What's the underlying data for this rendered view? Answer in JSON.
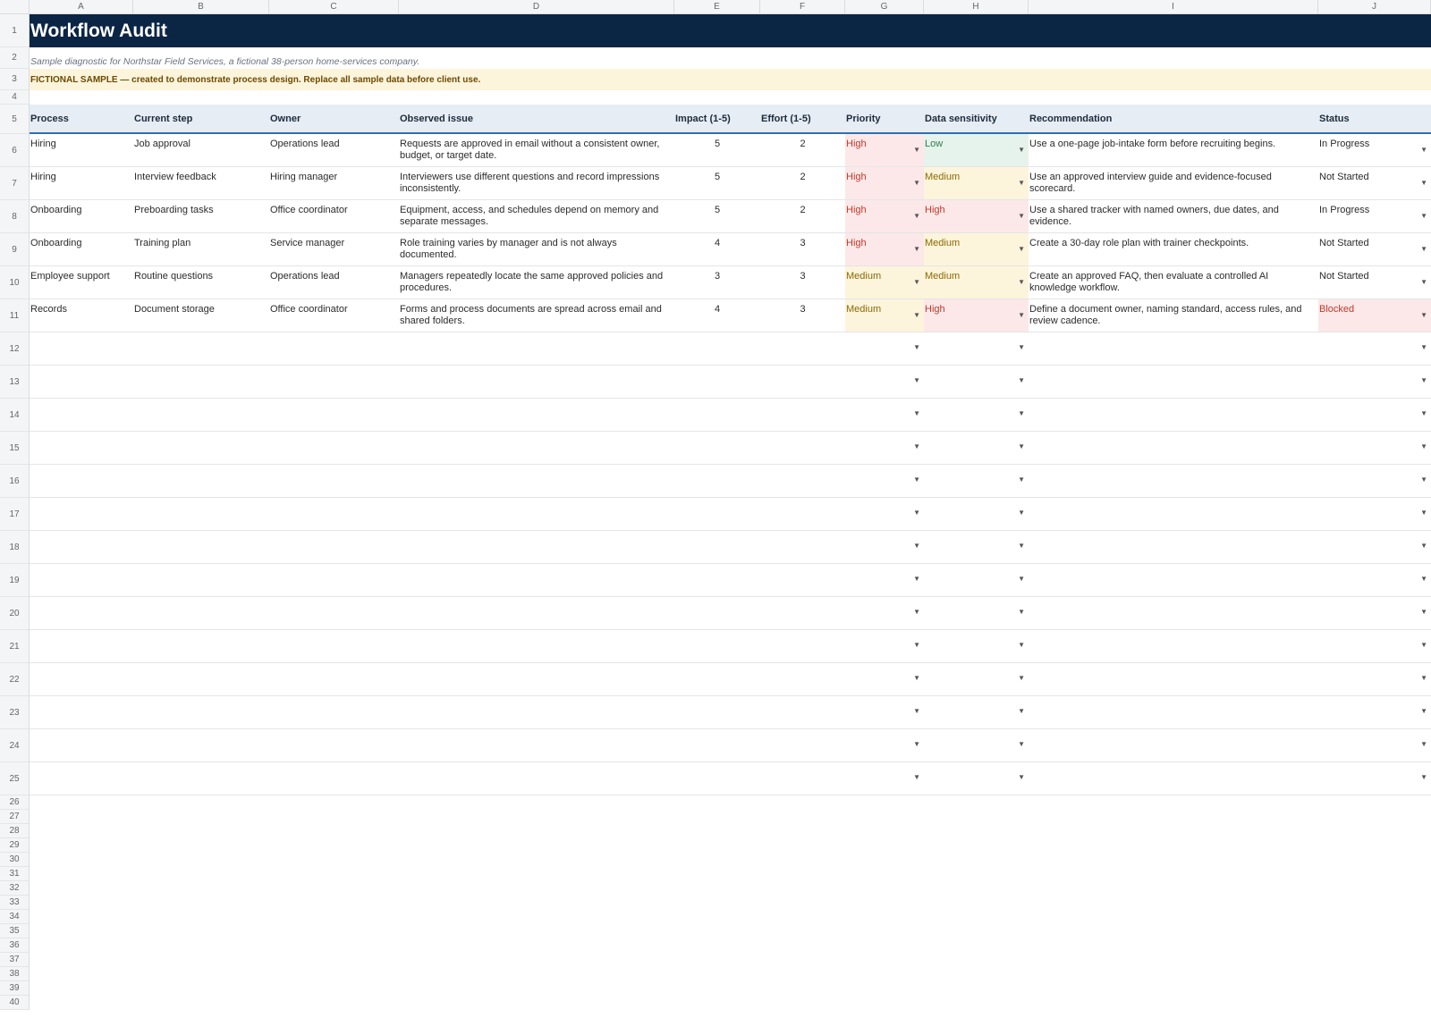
{
  "columns": [
    "A",
    "B",
    "C",
    "D",
    "E",
    "F",
    "G",
    "H",
    "I",
    "J"
  ],
  "rows_numbers": [
    1,
    2,
    3,
    4,
    5,
    6,
    7,
    8,
    9,
    10,
    11,
    12,
    13,
    14,
    15,
    16,
    17,
    18,
    19,
    20,
    21,
    22,
    23,
    24,
    25,
    26,
    27,
    28,
    29,
    30,
    31,
    32,
    33,
    34,
    35,
    36,
    37,
    38,
    39,
    40
  ],
  "title": "Workflow Audit",
  "subtitle": "Sample diagnostic for Northstar Field Services, a fictional 38-person home-services company.",
  "notice": "FICTIONAL SAMPLE — created to demonstrate process design. Replace all sample data before client use.",
  "headers": {
    "process": "Process",
    "current_step": "Current step",
    "owner": "Owner",
    "observed_issue": "Observed issue",
    "impact": "Impact (1-5)",
    "effort": "Effort (1-5)",
    "priority": "Priority",
    "data_sensitivity": "Data sensitivity",
    "recommendation": "Recommendation",
    "status": "Status"
  },
  "dropdown_caret": "▼",
  "records": [
    {
      "process": "Hiring",
      "current_step": "Job approval",
      "owner": "Operations lead",
      "observed_issue": "Requests are approved in email without a consistent owner, budget, or target date.",
      "impact": "5",
      "effort": "2",
      "priority": "High",
      "data_sensitivity": "Low",
      "recommendation": "Use a one-page job-intake form before recruiting begins.",
      "status": "In Progress"
    },
    {
      "process": "Hiring",
      "current_step": "Interview feedback",
      "owner": "Hiring manager",
      "observed_issue": "Interviewers use different questions and record impressions inconsistently.",
      "impact": "5",
      "effort": "2",
      "priority": "High",
      "data_sensitivity": "Medium",
      "recommendation": "Use an approved interview guide and evidence-focused scorecard.",
      "status": "Not Started"
    },
    {
      "process": "Onboarding",
      "current_step": "Preboarding tasks",
      "owner": "Office coordinator",
      "observed_issue": "Equipment, access, and schedules depend on memory and separate messages.",
      "impact": "5",
      "effort": "2",
      "priority": "High",
      "data_sensitivity": "High",
      "recommendation": "Use a shared tracker with named owners, due dates, and evidence.",
      "status": "In Progress"
    },
    {
      "process": "Onboarding",
      "current_step": "Training plan",
      "owner": "Service manager",
      "observed_issue": "Role training varies by manager and is not always documented.",
      "impact": "4",
      "effort": "3",
      "priority": "High",
      "data_sensitivity": "Medium",
      "recommendation": "Create a 30-day role plan with trainer checkpoints.",
      "status": "Not Started"
    },
    {
      "process": "Employee support",
      "current_step": "Routine questions",
      "owner": "Operations lead",
      "observed_issue": "Managers repeatedly locate the same approved policies and procedures.",
      "impact": "3",
      "effort": "3",
      "priority": "Medium",
      "data_sensitivity": "Medium",
      "recommendation": "Create an approved FAQ, then evaluate a controlled AI knowledge workflow.",
      "status": "Not Started"
    },
    {
      "process": "Records",
      "current_step": "Document storage",
      "owner": "Office coordinator",
      "observed_issue": "Forms and process documents are spread across email and shared folders.",
      "impact": "4",
      "effort": "3",
      "priority": "Medium",
      "data_sensitivity": "High",
      "recommendation": "Define a document owner, naming standard, access rules, and review cadence.",
      "status": "Blocked"
    }
  ],
  "colors": {
    "title_bg": "#0b2545",
    "header_bg": "#e6edf5",
    "header_border": "#2f6fb6",
    "high_bg": "#fce8e8",
    "high_text": "#c0392b",
    "medium_bg": "#fdf4dc",
    "medium_text": "#8a6a00",
    "low_bg": "#e6f3ec",
    "low_text": "#2e7d4f"
  }
}
